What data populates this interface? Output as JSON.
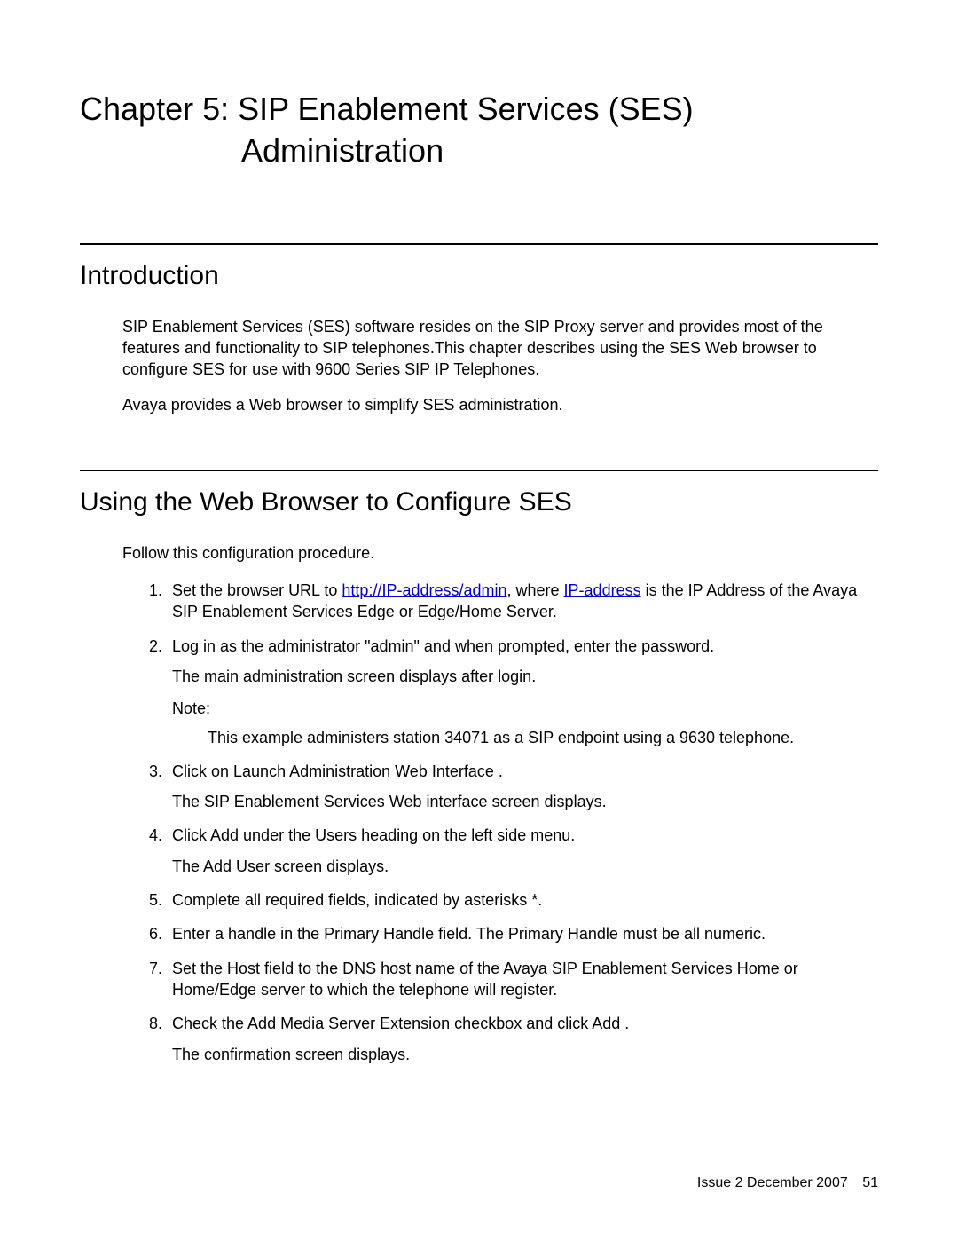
{
  "chapter": {
    "line1": "Chapter 5:  SIP Enablement Services (SES)",
    "line2": "Administration"
  },
  "section1": {
    "heading": "Introduction",
    "p1": "SIP Enablement Services (SES) software resides on the SIP Proxy server and provides most of the features and functionality to SIP telephones.This chapter describes using the SES Web browser to configure SES for use with 9600 Series SIP IP Telephones.",
    "p2": "Avaya provides a Web browser to simplify SES administration."
  },
  "section2": {
    "heading": "Using the Web Browser to Configure SES",
    "intro": "Follow this configuration procedure.",
    "items": {
      "s1_pre": "Set the browser URL to ",
      "s1_link1": "http://IP-address/admin",
      "s1_mid": ", where ",
      "s1_link2": "IP-address",
      "s1_post": " is the IP Address of the Avaya SIP Enablement Services Edge or Edge/Home Server.",
      "s2_main": "Log in as the administrator \"admin\" and when prompted, enter the password.",
      "s2_sub1": "The main administration screen displays after login.",
      "s2_note_label": "Note:",
      "s2_note_body": "This example administers station 34071 as a SIP endpoint using a 9630 telephone.",
      "s3_main": "Click on Launch Administration Web Interface    .",
      "s3_sub": "The SIP Enablement Services Web interface screen displays.",
      "s4_main": "Click Add  under the Users  heading on the left side menu.",
      "s4_sub": "The Add User screen displays.",
      "s5_main": "Complete all required fields, indicated by asterisks *.",
      "s6_main": "Enter a handle in the Primary Handle   field. The Primary Handle must be all numeric.",
      "s7_main": "Set the Host  field to the DNS host name of the Avaya SIP Enablement Services Home or Home/Edge server to which the telephone will register.",
      "s8_main": "Check the Add Media Server Extension    checkbox and click Add .",
      "s8_sub": "The confirmation screen displays."
    }
  },
  "footer": {
    "issue": "Issue 2   December 2007",
    "page": "51"
  }
}
